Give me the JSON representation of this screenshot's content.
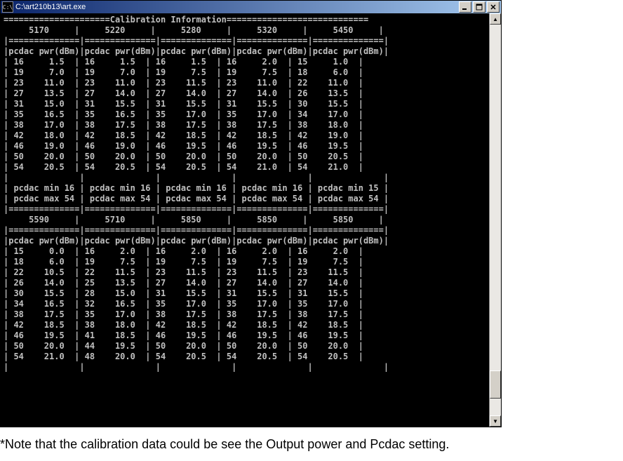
{
  "window": {
    "title": "C:\\art210b13\\art.exe",
    "icon_label": "C:\\"
  },
  "console": {
    "heading": "Calibration Information",
    "sections": [
      {
        "freqs": [
          "5170",
          "5220",
          "5280",
          "5320",
          "5450"
        ],
        "col_header": [
          "pcdac",
          "pwr(dBm)"
        ],
        "rows": [
          [
            [
              "16",
              "1.5"
            ],
            [
              "16",
              "1.5"
            ],
            [
              "16",
              "1.5"
            ],
            [
              "16",
              "2.0"
            ],
            [
              "15",
              "1.0"
            ]
          ],
          [
            [
              "19",
              "7.0"
            ],
            [
              "19",
              "7.0"
            ],
            [
              "19",
              "7.5"
            ],
            [
              "19",
              "7.5"
            ],
            [
              "18",
              "6.0"
            ]
          ],
          [
            [
              "23",
              "11.0"
            ],
            [
              "23",
              "11.0"
            ],
            [
              "23",
              "11.5"
            ],
            [
              "23",
              "11.0"
            ],
            [
              "22",
              "11.0"
            ]
          ],
          [
            [
              "27",
              "13.5"
            ],
            [
              "27",
              "14.0"
            ],
            [
              "27",
              "14.0"
            ],
            [
              "27",
              "14.0"
            ],
            [
              "26",
              "13.5"
            ]
          ],
          [
            [
              "31",
              "15.0"
            ],
            [
              "31",
              "15.5"
            ],
            [
              "31",
              "15.5"
            ],
            [
              "31",
              "15.5"
            ],
            [
              "30",
              "15.5"
            ]
          ],
          [
            [
              "35",
              "16.5"
            ],
            [
              "35",
              "16.5"
            ],
            [
              "35",
              "17.0"
            ],
            [
              "35",
              "17.0"
            ],
            [
              "34",
              "17.0"
            ]
          ],
          [
            [
              "38",
              "17.0"
            ],
            [
              "38",
              "17.5"
            ],
            [
              "38",
              "17.5"
            ],
            [
              "38",
              "17.5"
            ],
            [
              "38",
              "18.0"
            ]
          ],
          [
            [
              "42",
              "18.0"
            ],
            [
              "42",
              "18.5"
            ],
            [
              "42",
              "18.5"
            ],
            [
              "42",
              "18.5"
            ],
            [
              "42",
              "19.0"
            ]
          ],
          [
            [
              "46",
              "19.0"
            ],
            [
              "46",
              "19.0"
            ],
            [
              "46",
              "19.5"
            ],
            [
              "46",
              "19.5"
            ],
            [
              "46",
              "19.5"
            ]
          ],
          [
            [
              "50",
              "20.0"
            ],
            [
              "50",
              "20.0"
            ],
            [
              "50",
              "20.0"
            ],
            [
              "50",
              "20.0"
            ],
            [
              "50",
              "20.5"
            ]
          ],
          [
            [
              "54",
              "20.5"
            ],
            [
              "54",
              "20.5"
            ],
            [
              "54",
              "20.5"
            ],
            [
              "54",
              "21.0"
            ],
            [
              "54",
              "21.0"
            ]
          ]
        ],
        "min": [
          "16",
          "16",
          "16",
          "16",
          "15"
        ],
        "max": [
          "54",
          "54",
          "54",
          "54",
          "54"
        ]
      },
      {
        "freqs": [
          "5590",
          "5710",
          "5850",
          "5850",
          "5850"
        ],
        "col_header": [
          "pcdac",
          "pwr(dBm)"
        ],
        "rows": [
          [
            [
              "15",
              "0.0"
            ],
            [
              "16",
              "2.0"
            ],
            [
              "16",
              "2.0"
            ],
            [
              "16",
              "2.0"
            ],
            [
              "16",
              "2.0"
            ]
          ],
          [
            [
              "18",
              "6.0"
            ],
            [
              "19",
              "7.5"
            ],
            [
              "19",
              "7.5"
            ],
            [
              "19",
              "7.5"
            ],
            [
              "19",
              "7.5"
            ]
          ],
          [
            [
              "22",
              "10.5"
            ],
            [
              "22",
              "11.5"
            ],
            [
              "23",
              "11.5"
            ],
            [
              "23",
              "11.5"
            ],
            [
              "23",
              "11.5"
            ]
          ],
          [
            [
              "26",
              "14.0"
            ],
            [
              "25",
              "13.5"
            ],
            [
              "27",
              "14.0"
            ],
            [
              "27",
              "14.0"
            ],
            [
              "27",
              "14.0"
            ]
          ],
          [
            [
              "30",
              "15.5"
            ],
            [
              "28",
              "15.0"
            ],
            [
              "31",
              "15.5"
            ],
            [
              "31",
              "15.5"
            ],
            [
              "31",
              "15.5"
            ]
          ],
          [
            [
              "34",
              "16.5"
            ],
            [
              "32",
              "16.5"
            ],
            [
              "35",
              "17.0"
            ],
            [
              "35",
              "17.0"
            ],
            [
              "35",
              "17.0"
            ]
          ],
          [
            [
              "38",
              "17.5"
            ],
            [
              "35",
              "17.0"
            ],
            [
              "38",
              "17.5"
            ],
            [
              "38",
              "17.5"
            ],
            [
              "38",
              "17.5"
            ]
          ],
          [
            [
              "42",
              "18.5"
            ],
            [
              "38",
              "18.0"
            ],
            [
              "42",
              "18.5"
            ],
            [
              "42",
              "18.5"
            ],
            [
              "42",
              "18.5"
            ]
          ],
          [
            [
              "46",
              "19.5"
            ],
            [
              "41",
              "18.5"
            ],
            [
              "46",
              "19.5"
            ],
            [
              "46",
              "19.5"
            ],
            [
              "46",
              "19.5"
            ]
          ],
          [
            [
              "50",
              "20.0"
            ],
            [
              "44",
              "19.5"
            ],
            [
              "50",
              "20.0"
            ],
            [
              "50",
              "20.0"
            ],
            [
              "50",
              "20.0"
            ]
          ],
          [
            [
              "54",
              "21.0"
            ],
            [
              "48",
              "20.0"
            ],
            [
              "54",
              "20.5"
            ],
            [
              "54",
              "20.5"
            ],
            [
              "54",
              "20.5"
            ]
          ]
        ]
      }
    ]
  },
  "footnote": "*Note that the calibration data could be see the Output power and Pcdac setting."
}
